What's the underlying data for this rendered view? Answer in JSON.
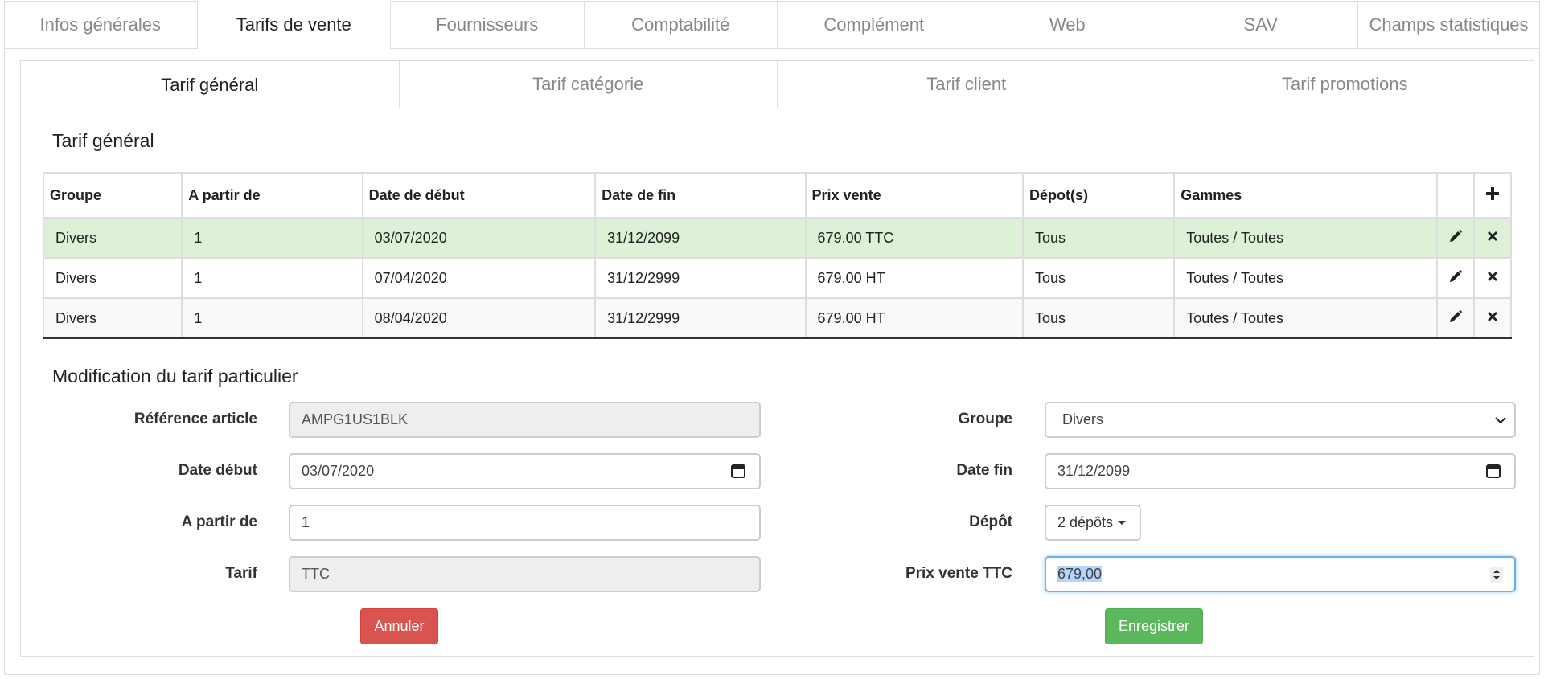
{
  "top_tabs": [
    "Infos générales",
    "Tarifs de vente",
    "Fournisseurs",
    "Comptabilité",
    "Complément",
    "Web",
    "SAV",
    "Champs statistiques"
  ],
  "top_tab_active": 1,
  "sub_tabs": [
    "Tarif général",
    "Tarif catégorie",
    "Tarif client",
    "Tarif promotions"
  ],
  "sub_tab_active": 0,
  "section1_title": "Tarif général",
  "table": {
    "headers": [
      "Groupe",
      "A partir de",
      "Date de début",
      "Date de fin",
      "Prix vente",
      "Dépot(s)",
      "Gammes"
    ],
    "add_icon": "plus-icon",
    "rows": [
      {
        "groupe": "Divers",
        "a_partir_de": "1",
        "date_debut": "03/07/2020",
        "date_fin": "31/12/2099",
        "prix": "679.00 TTC",
        "depots": "Tous",
        "gammes": "Toutes / Toutes",
        "state": "success"
      },
      {
        "groupe": "Divers",
        "a_partir_de": "1",
        "date_debut": "07/04/2020",
        "date_fin": "31/12/2999",
        "prix": "679.00 HT",
        "depots": "Tous",
        "gammes": "Toutes / Toutes",
        "state": "normal"
      },
      {
        "groupe": "Divers",
        "a_partir_de": "1",
        "date_debut": "08/04/2020",
        "date_fin": "31/12/2999",
        "prix": "679.00 HT",
        "depots": "Tous",
        "gammes": "Toutes / Toutes",
        "state": "striped"
      }
    ]
  },
  "section2_title": "Modification du tarif particulier",
  "form": {
    "ref_label": "Référence article",
    "ref_value": "AMPG1US1BLK",
    "date_debut_label": "Date début",
    "date_debut_value": "03/07/2020",
    "a_partir_label": "A partir de",
    "a_partir_value": "1",
    "tarif_label": "Tarif",
    "tarif_value": "TTC",
    "groupe_label": "Groupe",
    "groupe_value": "Divers",
    "date_fin_label": "Date fin",
    "date_fin_value": "31/12/2099",
    "depot_label": "Dépôt",
    "depot_value": "2 dépôts",
    "prix_label": "Prix vente TTC",
    "prix_value": "679,00",
    "cancel_label": "Annuler",
    "save_label": "Enregistrer"
  },
  "colors": {
    "success_row": "#dff0d8",
    "cancel": "#d9534f",
    "save": "#5cb85c",
    "focus": "#66afe9"
  }
}
